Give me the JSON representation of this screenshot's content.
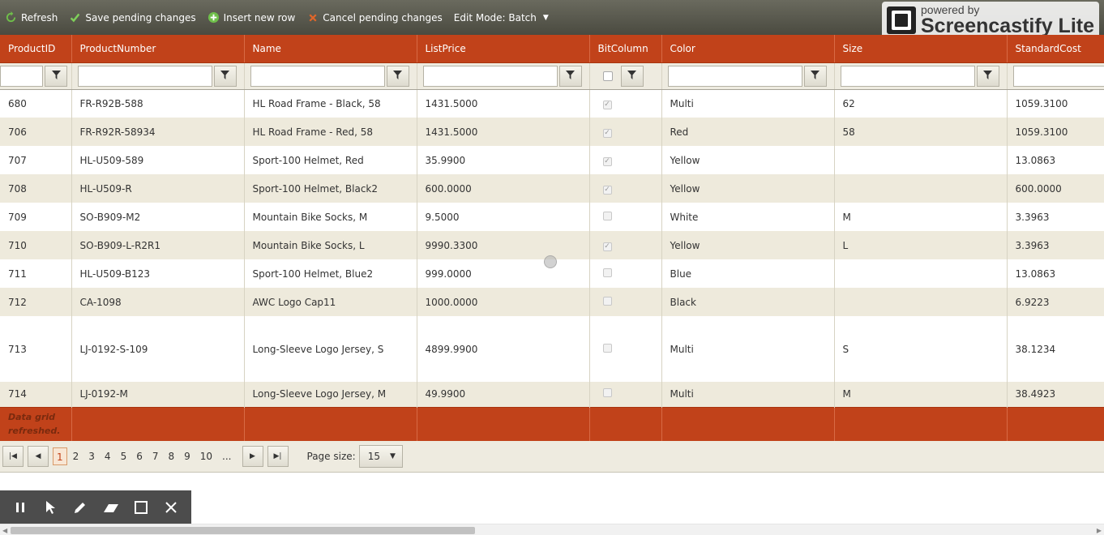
{
  "toolbar": {
    "refresh_label": "Refresh",
    "save_label": "Save pending changes",
    "insert_label": "Insert new row",
    "cancel_label": "Cancel pending changes",
    "edit_mode_label": "Edit Mode: Batch"
  },
  "watermark": {
    "small": "powered by",
    "big": "Screencastify Lite"
  },
  "grid": {
    "columns": [
      "ProductID",
      "ProductNumber",
      "Name",
      "ListPrice",
      "BitColumn",
      "Color",
      "Size",
      "StandardCost"
    ],
    "rows": [
      {
        "id": "680",
        "number": "FR-R92B-588",
        "name": "HL Road Frame - Black, 58",
        "price": "1431.5000",
        "bit": true,
        "color": "Multi",
        "size": "62",
        "cost": "1059.3100"
      },
      {
        "id": "706",
        "number": "FR-R92R-58934",
        "name": "HL Road Frame - Red, 58",
        "price": "1431.5000",
        "bit": true,
        "color": "Red",
        "size": "58",
        "cost": "1059.3100"
      },
      {
        "id": "707",
        "number": "HL-U509-589",
        "name": "Sport-100 Helmet, Red",
        "price": "35.9900",
        "bit": true,
        "color": "Yellow",
        "size": "",
        "cost": "13.0863"
      },
      {
        "id": "708",
        "number": "HL-U509-R",
        "name": "Sport-100 Helmet, Black2",
        "price": "600.0000",
        "bit": true,
        "color": "Yellow",
        "size": "",
        "cost": "600.0000"
      },
      {
        "id": "709",
        "number": "SO-B909-M2",
        "name": "Mountain Bike Socks, M",
        "price": "9.5000",
        "bit": false,
        "color": "White",
        "size": "M",
        "cost": "3.3963"
      },
      {
        "id": "710",
        "number": "SO-B909-L-R2R1",
        "name": "Mountain Bike Socks, L",
        "price": "9990.3300",
        "bit": true,
        "color": "Yellow",
        "size": "L",
        "cost": "3.3963"
      },
      {
        "id": "711",
        "number": "HL-U509-B123",
        "name": "Sport-100 Helmet, Blue2",
        "price": "999.0000",
        "bit": false,
        "color": "Blue",
        "size": "",
        "cost": "13.0863"
      },
      {
        "id": "712",
        "number": "CA-1098",
        "name": "AWC Logo Cap11",
        "price": "1000.0000",
        "bit": false,
        "color": "Black",
        "size": "",
        "cost": "6.9223"
      },
      {
        "id": "713",
        "number": "LJ-0192-S-109",
        "name": "Long-Sleeve Logo Jersey, S",
        "price": "4899.9900",
        "bit": false,
        "color": "Multi",
        "size": "S",
        "cost": "38.1234"
      },
      {
        "id": "714",
        "number": "LJ-0192-M",
        "name": "Long-Sleeve Logo Jersey, M",
        "price": "49.9900",
        "bit": false,
        "color": "Multi",
        "size": "M",
        "cost": "38.4923"
      }
    ],
    "footer_message": "Data grid refreshed."
  },
  "pager": {
    "pages": [
      "1",
      "2",
      "3",
      "4",
      "5",
      "6",
      "7",
      "8",
      "9",
      "10",
      "..."
    ],
    "current_page": "1",
    "page_size_label": "Page size:",
    "page_size": "15"
  },
  "colors": {
    "header": "#c1421a",
    "toolbar": "#55554a",
    "alt_row": "#eeeadc",
    "filter_row": "#eeebe0"
  }
}
